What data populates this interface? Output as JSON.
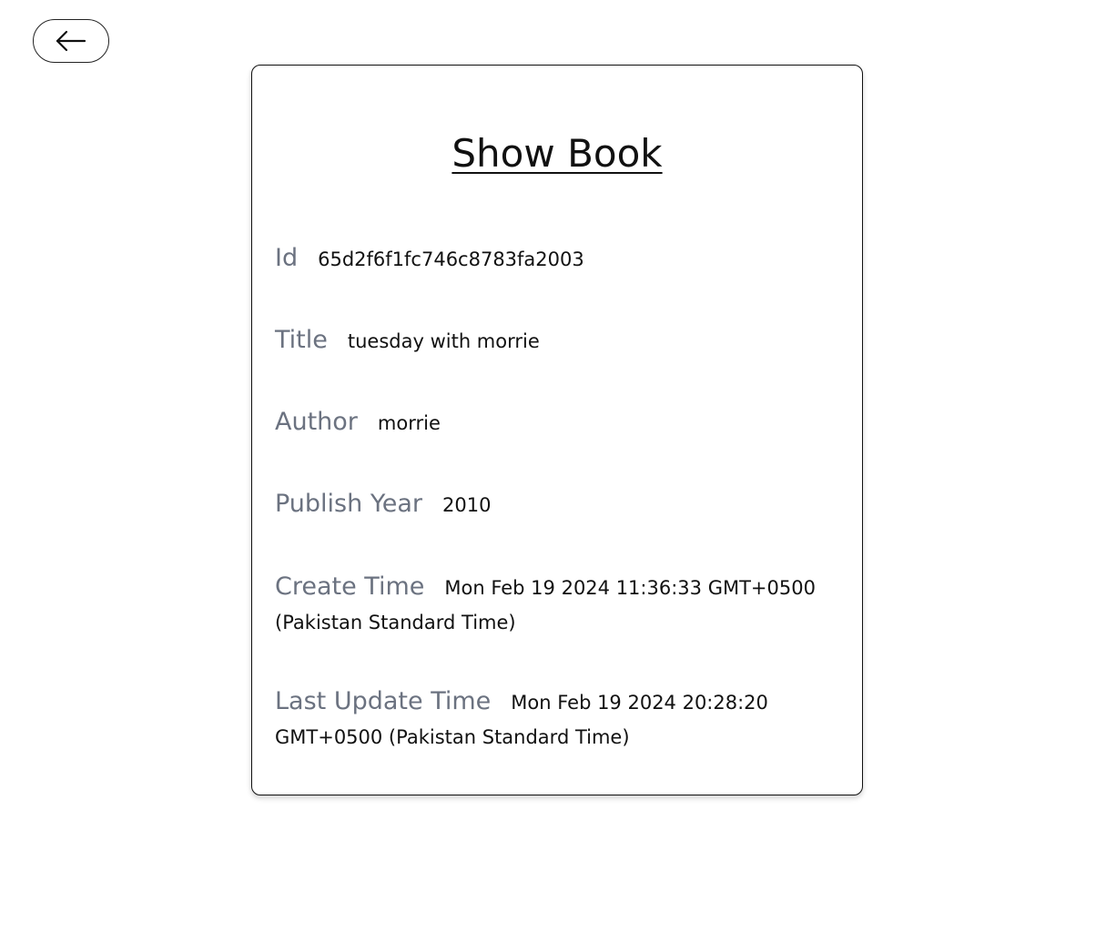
{
  "nav": {
    "back_icon": "arrow-left-icon"
  },
  "card": {
    "title": "Show Book",
    "fields": [
      {
        "label": "Id",
        "value": "65d2f6f1fc746c8783fa2003"
      },
      {
        "label": "Title",
        "value": "tuesday with morrie"
      },
      {
        "label": "Author",
        "value": "morrie"
      },
      {
        "label": "Publish Year",
        "value": "2010"
      },
      {
        "label": "Create Time",
        "value": "Mon Feb 19 2024 11:36:33 GMT+0500 (Pakistan Standard Time)"
      },
      {
        "label": "Last Update Time",
        "value": "Mon Feb 19 2024 20:28:20 GMT+0500 (Pakistan Standard Time)"
      }
    ]
  },
  "colors": {
    "label": "#6b7280",
    "text": "#111111",
    "border": "#111111"
  }
}
